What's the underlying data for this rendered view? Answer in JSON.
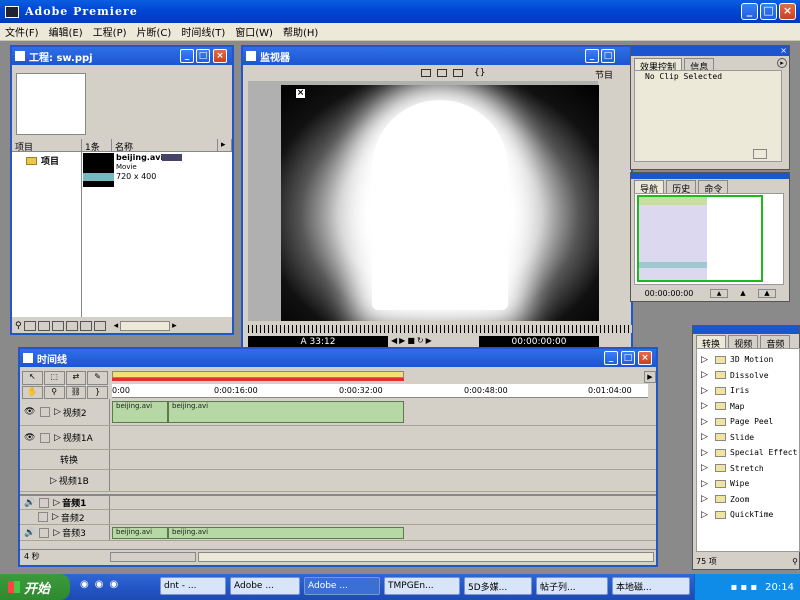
{
  "app": {
    "title": "Adobe Premiere"
  },
  "menu": [
    "文件(F)",
    "编辑(E)",
    "工程(P)",
    "片断(C)",
    "时间线(T)",
    "窗口(W)",
    "帮助(H)"
  ],
  "project": {
    "title": "工程: sw.ppj",
    "bin_header": "项目",
    "bin_item": "项目",
    "count_header": "1条",
    "name_header": "名称",
    "clip_name": "beijing.avi",
    "clip_type": "Movie",
    "clip_size": "720 x 400"
  },
  "monitor": {
    "title": "监视器",
    "section_label": "节目",
    "timecode_left": "A 33:12",
    "timecode_right": "00:00:00:00"
  },
  "effects": {
    "tabs": [
      "效果控制",
      "信息"
    ],
    "status": "No Clip Selected"
  },
  "navigator": {
    "tabs": [
      "导航",
      "历史",
      "命令"
    ],
    "timecode": "00:00:00:00"
  },
  "transitions": {
    "tabs": [
      "转换",
      "视频",
      "音频"
    ],
    "items": [
      "3D Motion",
      "Dissolve",
      "Iris",
      "Map",
      "Page Peel",
      "Slide",
      "Special Effect",
      "Stretch",
      "Wipe",
      "Zoom",
      "QuickTime"
    ],
    "count": "75 项"
  },
  "timeline": {
    "title": "时间线",
    "ruler": [
      "0:00",
      "0:00:16:00",
      "0:00:32:00",
      "0:00:48:00",
      "0:01:04:00"
    ],
    "tracks": {
      "video2": "视频2",
      "video1a": "视频1A",
      "transition": "转换",
      "video1b": "视频1B",
      "audio1": "音频1",
      "audio2": "音频2",
      "audio3": "音频3"
    },
    "clip_label": "beijing.avi",
    "zoom": "4 秒"
  },
  "taskbar": {
    "start": "开始",
    "buttons": [
      "dnt - ...",
      "Adobe ...",
      "Adobe ...",
      "TMPGEn...",
      "5D多媒...",
      "帖子列...",
      "本地磁..."
    ],
    "clock": "20:14"
  }
}
